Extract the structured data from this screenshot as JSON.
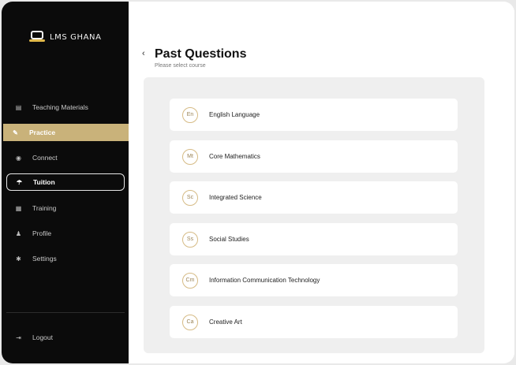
{
  "app": {
    "logo_text": "LMS GHANA"
  },
  "nav": {
    "items": [
      {
        "label": "Teaching Materials",
        "icon": "book-icon",
        "glyph": "▤",
        "state": "normal"
      },
      {
        "label": "Practice",
        "icon": "practice-icon",
        "glyph": "✎",
        "state": "active"
      },
      {
        "label": "Connect",
        "icon": "connect-icon",
        "glyph": "◉",
        "state": "normal"
      },
      {
        "label": "Tuition",
        "icon": "tuition-icon",
        "glyph": "☂",
        "state": "outlined"
      },
      {
        "label": "Training",
        "icon": "training-icon",
        "glyph": "▦",
        "state": "normal"
      },
      {
        "label": "Profile",
        "icon": "profile-icon",
        "glyph": "♟",
        "state": "normal"
      },
      {
        "label": "Settings",
        "icon": "gear-icon",
        "glyph": "✱",
        "state": "normal"
      }
    ],
    "logout": {
      "label": "Logout",
      "icon": "logout-icon",
      "glyph": "⇥"
    }
  },
  "main": {
    "back_glyph": "‹",
    "title": "Past Questions",
    "subtitle": "Please select course",
    "courses": [
      {
        "badge": "En",
        "label": "English Language"
      },
      {
        "badge": "Mt",
        "label": "Core Mathematics"
      },
      {
        "badge": "Sc",
        "label": "Integrated Science"
      },
      {
        "badge": "Ss",
        "label": "Social Studies"
      },
      {
        "badge": "Cm",
        "label": "Information Communication Technology"
      },
      {
        "badge": "Ca",
        "label": "Creative Art"
      }
    ]
  },
  "colors": {
    "accent": "#c9b27a",
    "sidebar": "#0b0b0b",
    "badge_border": "#d6bb85"
  }
}
